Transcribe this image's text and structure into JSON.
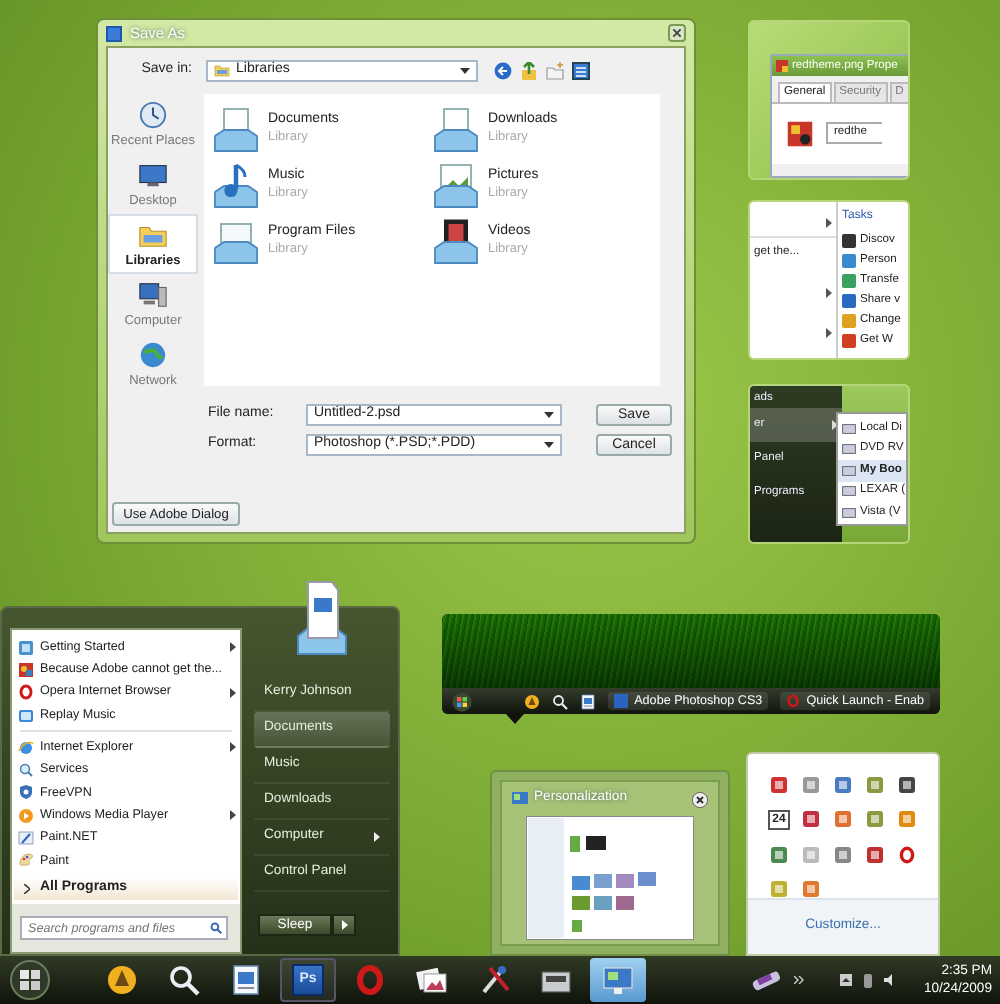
{
  "save_dialog": {
    "title": "Save As",
    "save_in_label": "Save in:",
    "save_in": "Libraries",
    "places": [
      {
        "label": "Recent Places",
        "kind": "recent",
        "selected": false
      },
      {
        "label": "Desktop",
        "kind": "desktop",
        "selected": false
      },
      {
        "label": "Libraries",
        "kind": "libraries",
        "selected": true
      },
      {
        "label": "Computer",
        "kind": "computer",
        "selected": false
      },
      {
        "label": "Network",
        "kind": "network",
        "selected": false
      }
    ],
    "items": [
      {
        "name": "Documents",
        "type": "Library",
        "kind": "documents"
      },
      {
        "name": "Downloads",
        "type": "Library",
        "kind": "downloads"
      },
      {
        "name": "Music",
        "type": "Library",
        "kind": "music"
      },
      {
        "name": "Pictures",
        "type": "Library",
        "kind": "pictures"
      },
      {
        "name": "Program Files",
        "type": "Library",
        "kind": "program-files"
      },
      {
        "name": "Videos",
        "type": "Library",
        "kind": "videos"
      }
    ],
    "file_name_label": "File name:",
    "file_name": "Untitled-2.psd",
    "format_label": "Format:",
    "format": "Photoshop (*.PSD;*.PDD)",
    "save_button": "Save",
    "cancel_button": "Cancel",
    "adobe_button": "Use Adobe Dialog"
  },
  "properties_thumbnail": {
    "title": "redtheme.png Prope",
    "tabs": [
      {
        "label": "General",
        "selected": true
      },
      {
        "label": "Security",
        "selected": false
      },
      {
        "label": "D",
        "selected": false
      }
    ],
    "file_name": "redthe"
  },
  "tasks_thumbnail": {
    "menu_rows": [
      {
        "arrow": true
      },
      {
        "label": "get the...",
        "arrow": false
      },
      {
        "arrow": true
      },
      {
        "arrow": true
      }
    ],
    "tasks_header": "Tasks",
    "tasks": [
      {
        "label": "Discov"
      },
      {
        "label": "Person"
      },
      {
        "label": "Transfe"
      },
      {
        "label": "Share v"
      },
      {
        "label": "Change"
      },
      {
        "label": "Get W"
      }
    ]
  },
  "computer_thumbnail": {
    "menu_items": [
      {
        "label": "ads",
        "arrow": false,
        "selected": false
      },
      {
        "label": "er",
        "arrow": true,
        "selected": true
      },
      {
        "label": "Panel",
        "arrow": false,
        "selected": false
      },
      {
        "label": "Programs",
        "arrow": false,
        "selected": false
      }
    ],
    "drives": [
      {
        "label": "Local Di",
        "selected": false
      },
      {
        "label": "DVD RV",
        "selected": false
      },
      {
        "label": "My Boo",
        "selected": true
      },
      {
        "label": "LEXAR (",
        "selected": false
      },
      {
        "label": "Vista (V",
        "selected": false
      }
    ]
  },
  "start_menu": {
    "pinned": [
      {
        "label": "Getting Started",
        "kind": "getting-started",
        "arrow": true
      },
      {
        "label": "Because Adobe cannot get the...",
        "kind": "adobe",
        "arrow": false
      },
      {
        "label": "Opera Internet Browser",
        "kind": "opera",
        "arrow": true
      },
      {
        "label": "Replay Music",
        "kind": "replay",
        "arrow": false
      }
    ],
    "recent": [
      {
        "label": "Internet Explorer",
        "kind": "ie",
        "arrow": true
      },
      {
        "label": "Services",
        "kind": "services",
        "arrow": false
      },
      {
        "label": "FreeVPN",
        "kind": "vpn",
        "arrow": false
      },
      {
        "label": "Windows Media Player",
        "kind": "wmp",
        "arrow": true
      },
      {
        "label": "Paint.NET",
        "kind": "paintnet",
        "arrow": false
      },
      {
        "label": "Paint",
        "kind": "paint",
        "arrow": false
      }
    ],
    "all_programs": "All Programs",
    "search_placeholder": "Search programs and files",
    "links": [
      {
        "label": "Kerry Johnson",
        "selected": false,
        "arrow": false
      },
      {
        "label": "Documents",
        "selected": true,
        "arrow": false
      },
      {
        "label": "Music",
        "selected": false,
        "arrow": false
      },
      {
        "label": "Downloads",
        "selected": false,
        "arrow": false
      },
      {
        "label": "Computer",
        "selected": false,
        "arrow": true
      },
      {
        "label": "Control Panel",
        "selected": false,
        "arrow": false
      }
    ],
    "sleep_button": "Sleep"
  },
  "taskbar_preview": {
    "buttons": [
      {
        "label": "Adobe Photoshop CS3",
        "kind": "ps"
      },
      {
        "label": "Quick Launch - Enab",
        "kind": "opera"
      }
    ]
  },
  "personalization_thumbnail": {
    "title": "Personalization"
  },
  "tray_overflow": {
    "calendar_label": "24",
    "customize_link": "Customize..."
  },
  "taskbar": {
    "apps": [
      {
        "kind": "cone",
        "selected": false
      },
      {
        "kind": "search",
        "selected": false
      },
      {
        "kind": "document",
        "selected": false
      },
      {
        "kind": "ps",
        "label": "Ps",
        "selected": false
      },
      {
        "kind": "opera",
        "selected": false
      },
      {
        "kind": "photos",
        "selected": false
      },
      {
        "kind": "tools",
        "selected": false
      },
      {
        "kind": "drive",
        "selected": false
      },
      {
        "kind": "display",
        "selected": true
      }
    ],
    "time": "2:35 PM",
    "date": "10/24/2009"
  }
}
